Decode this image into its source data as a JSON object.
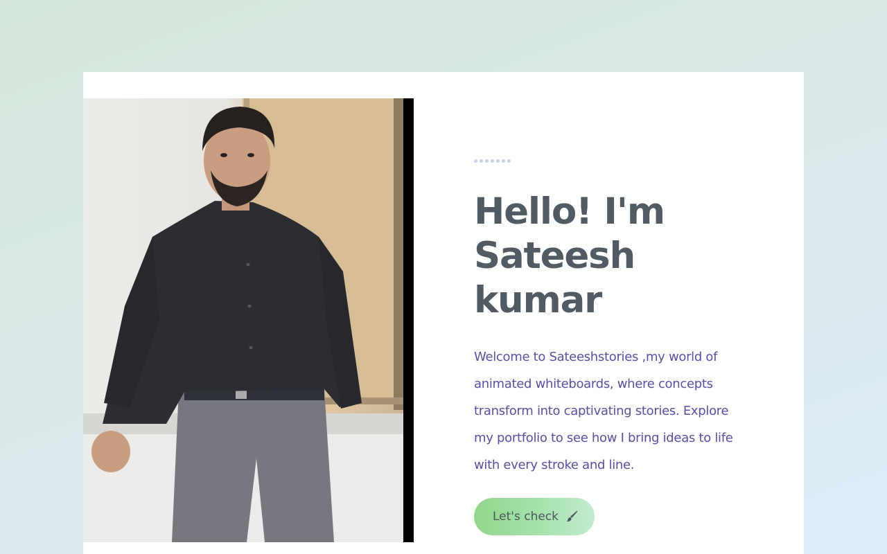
{
  "hero": {
    "heading_line1": "Hello! I'm",
    "heading_line2": "Sateesh kumar",
    "intro": "Welcome to Sateeshstories ,my world of animated whiteboards, where concepts transform into captivating stories. Explore my portfolio to see how I bring ideas to life with every stroke and line.",
    "cta_label": "Let's check",
    "cta_icon": "paint-brush-icon",
    "decorative_dots": 7
  },
  "colors": {
    "heading": "#525a63",
    "intro_text": "#5550a8",
    "cta_gradient_start": "#8fd68a",
    "cta_gradient_end": "#c3ecd0",
    "card": "#ffffff"
  }
}
